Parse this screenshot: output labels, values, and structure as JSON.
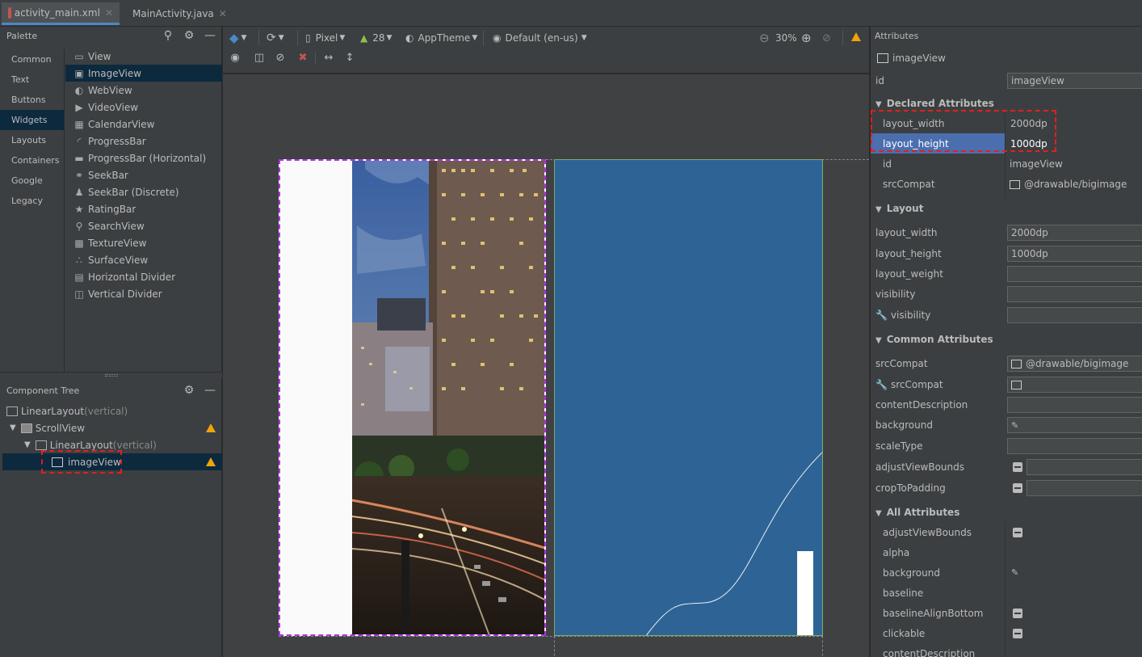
{
  "tabs": [
    {
      "label": "activity_main.xml",
      "active": true,
      "icon": "layout-file-icon"
    },
    {
      "label": "MainActivity.java",
      "active": false,
      "icon": "java-class-icon"
    }
  ],
  "palette": {
    "title": "Palette",
    "categories": [
      "Common",
      "Text",
      "Buttons",
      "Widgets",
      "Layouts",
      "Containers",
      "Google",
      "Legacy"
    ],
    "selected_category": "Widgets",
    "widgets": [
      {
        "label": "View",
        "icon": "view-icon"
      },
      {
        "label": "ImageView",
        "icon": "image-icon"
      },
      {
        "label": "WebView",
        "icon": "globe-icon"
      },
      {
        "label": "VideoView",
        "icon": "video-icon"
      },
      {
        "label": "CalendarView",
        "icon": "calendar-icon"
      },
      {
        "label": "ProgressBar",
        "icon": "progress-circle-icon"
      },
      {
        "label": "ProgressBar (Horizontal)",
        "icon": "progress-bar-icon"
      },
      {
        "label": "SeekBar",
        "icon": "seekbar-icon"
      },
      {
        "label": "SeekBar (Discrete)",
        "icon": "seekbar-discrete-icon"
      },
      {
        "label": "RatingBar",
        "icon": "star-icon"
      },
      {
        "label": "SearchView",
        "icon": "search-icon"
      },
      {
        "label": "TextureView",
        "icon": "texture-icon"
      },
      {
        "label": "SurfaceView",
        "icon": "surface-icon"
      },
      {
        "label": "Horizontal Divider",
        "icon": "horizontal-divider-icon"
      },
      {
        "label": "Vertical Divider",
        "icon": "vertical-divider-icon"
      }
    ],
    "selected_widget": "ImageView"
  },
  "component_tree": {
    "title": "Component Tree",
    "nodes": [
      {
        "label": "LinearLayout",
        "suffix": "(vertical)",
        "warning": false
      },
      {
        "label": "ScrollView",
        "suffix": "",
        "warning": true
      },
      {
        "label": "LinearLayout",
        "suffix": "(vertical)",
        "warning": false
      },
      {
        "label": "imageView",
        "suffix": "",
        "warning": true
      }
    ]
  },
  "toolbar": {
    "device": "Pixel",
    "api": "28",
    "theme": "AppTheme",
    "locale": "Default (en-us)",
    "zoom": "30%"
  },
  "attributes": {
    "title": "Attributes",
    "component_name": "imageView",
    "id_label": "id",
    "id_value": "imageView",
    "declared": {
      "title": "Declared Attributes",
      "rows": [
        {
          "name": "layout_width",
          "value": "2000dp"
        },
        {
          "name": "layout_height",
          "value": "1000dp"
        },
        {
          "name": "id",
          "value": "imageView"
        },
        {
          "name": "srcCompat",
          "value": "@drawable/bigimage"
        }
      ]
    },
    "layout": {
      "title": "Layout",
      "rows": [
        {
          "name": "layout_width",
          "value": "2000dp"
        },
        {
          "name": "layout_height",
          "value": "1000dp"
        },
        {
          "name": "layout_weight",
          "value": ""
        },
        {
          "name": "visibility",
          "value": ""
        },
        {
          "name": "visibility",
          "value": ""
        }
      ]
    },
    "common": {
      "title": "Common Attributes",
      "rows": [
        {
          "name": "srcCompat",
          "value": "@drawable/bigimage"
        },
        {
          "name": "srcCompat",
          "value": ""
        },
        {
          "name": "contentDescription",
          "value": ""
        },
        {
          "name": "background",
          "value": ""
        },
        {
          "name": "scaleType",
          "value": ""
        },
        {
          "name": "adjustViewBounds",
          "value": ""
        },
        {
          "name": "cropToPadding",
          "value": ""
        }
      ]
    },
    "all": {
      "title": "All Attributes",
      "rows": [
        {
          "name": "adjustViewBounds"
        },
        {
          "name": "alpha"
        },
        {
          "name": "background"
        },
        {
          "name": "baseline"
        },
        {
          "name": "baselineAlignBottom"
        },
        {
          "name": "clickable"
        },
        {
          "name": "contentDescription"
        }
      ]
    }
  },
  "colors": {
    "accent": "#4a88c7",
    "selection": "#0d293e",
    "highlight_row": "#4b6eaf",
    "warning": "#f0a30a",
    "blueprint": "#2d6495",
    "annotation_box": "#e02020"
  }
}
